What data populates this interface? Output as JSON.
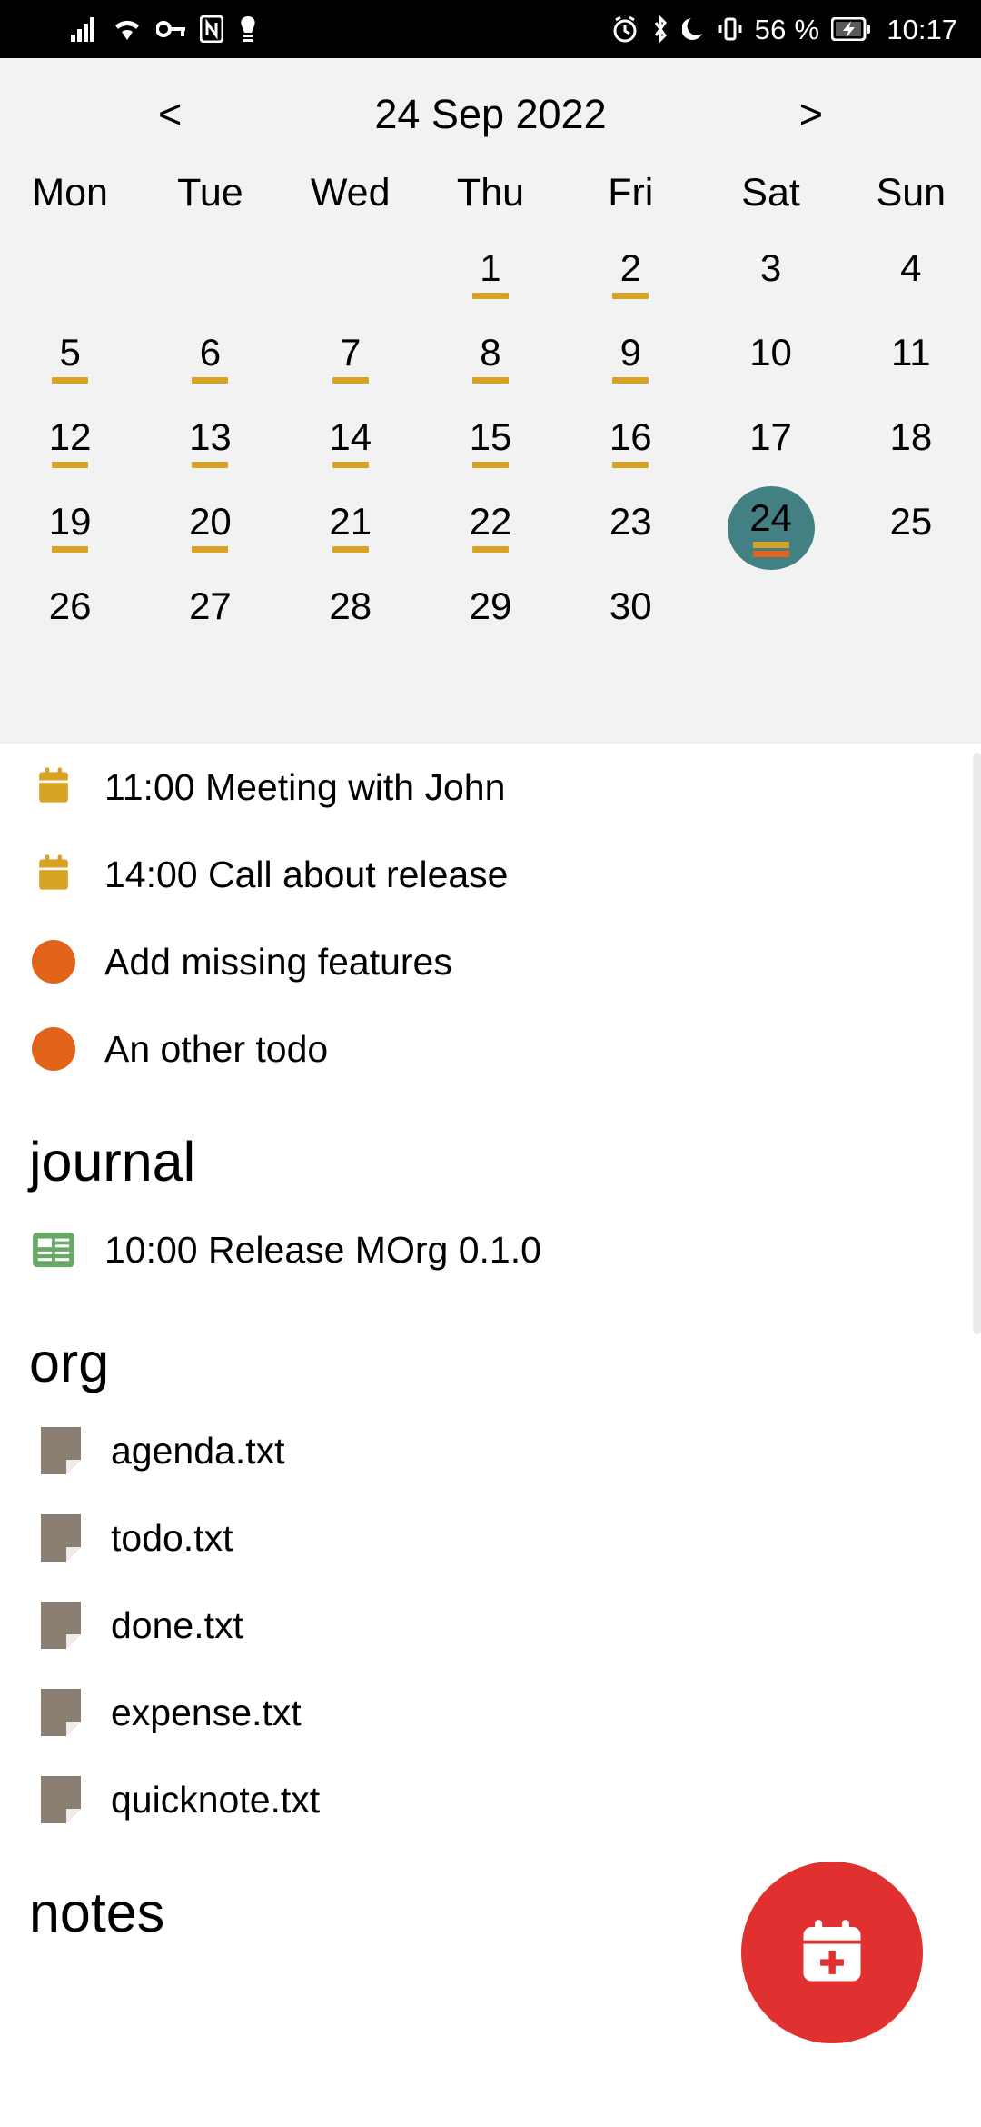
{
  "status_bar": {
    "left_icons": [
      "signal-bars-icon",
      "wifi-icon",
      "vpn-key-icon",
      "nfc-icon",
      "bulb-icon"
    ],
    "right_icons": [
      "alarm-icon",
      "bluetooth-icon",
      "do-not-disturb-icon",
      "vibrate-icon"
    ],
    "battery_percent": "56 %",
    "battery_icon": "battery-charging-icon",
    "clock": "10:17"
  },
  "calendar": {
    "prev_label": "<",
    "title": "24 Sep 2022",
    "next_label": ">",
    "weekdays": [
      "Mon",
      "Tue",
      "Wed",
      "Thu",
      "Fri",
      "Sat",
      "Sun"
    ],
    "selected_day": 24,
    "marker_colors": {
      "appointment": "#d8a325",
      "todo": "#e2631a"
    },
    "selected_bg": "#438083",
    "weeks": [
      [
        {
          "day": "",
          "marks": []
        },
        {
          "day": "",
          "marks": []
        },
        {
          "day": "",
          "marks": []
        },
        {
          "day": "1",
          "marks": [
            "appointment"
          ]
        },
        {
          "day": "2",
          "marks": [
            "appointment"
          ]
        },
        {
          "day": "3",
          "marks": []
        },
        {
          "day": "4",
          "marks": []
        }
      ],
      [
        {
          "day": "5",
          "marks": [
            "appointment"
          ]
        },
        {
          "day": "6",
          "marks": [
            "appointment"
          ]
        },
        {
          "day": "7",
          "marks": [
            "appointment"
          ]
        },
        {
          "day": "8",
          "marks": [
            "appointment"
          ]
        },
        {
          "day": "9",
          "marks": [
            "appointment"
          ]
        },
        {
          "day": "10",
          "marks": []
        },
        {
          "day": "11",
          "marks": []
        }
      ],
      [
        {
          "day": "12",
          "marks": [
            "appointment"
          ]
        },
        {
          "day": "13",
          "marks": [
            "appointment"
          ]
        },
        {
          "day": "14",
          "marks": [
            "appointment"
          ]
        },
        {
          "day": "15",
          "marks": [
            "appointment"
          ]
        },
        {
          "day": "16",
          "marks": [
            "appointment"
          ]
        },
        {
          "day": "17",
          "marks": []
        },
        {
          "day": "18",
          "marks": []
        }
      ],
      [
        {
          "day": "19",
          "marks": [
            "appointment"
          ]
        },
        {
          "day": "20",
          "marks": [
            "appointment"
          ]
        },
        {
          "day": "21",
          "marks": [
            "appointment"
          ]
        },
        {
          "day": "22",
          "marks": [
            "appointment"
          ]
        },
        {
          "day": "23",
          "marks": []
        },
        {
          "day": "24",
          "marks": [
            "appointment",
            "todo"
          ],
          "selected": true
        },
        {
          "day": "25",
          "marks": []
        }
      ],
      [
        {
          "day": "26",
          "marks": []
        },
        {
          "day": "27",
          "marks": []
        },
        {
          "day": "28",
          "marks": []
        },
        {
          "day": "29",
          "marks": []
        },
        {
          "day": "30",
          "marks": []
        },
        {
          "day": "",
          "marks": []
        },
        {
          "day": "",
          "marks": []
        }
      ]
    ]
  },
  "agenda": {
    "items": [
      {
        "icon": "calendar-icon",
        "icon_color": "#d8a325",
        "label": "11:00 Meeting with John"
      },
      {
        "icon": "calendar-icon",
        "icon_color": "#d8a325",
        "label": "14:00 Call about release"
      },
      {
        "icon": "todo-dot-icon",
        "icon_color": "#e2631a",
        "label": "Add missing features"
      },
      {
        "icon": "todo-dot-icon",
        "icon_color": "#e2631a",
        "label": "An other todo"
      }
    ]
  },
  "journal": {
    "title": "journal",
    "items": [
      {
        "icon": "article-icon",
        "icon_color": "#6aa86a",
        "label": "10:00 Release MOrg 0.1.0"
      }
    ]
  },
  "org": {
    "title": "org",
    "file_icon_color": "#8a7f72",
    "files": [
      {
        "icon": "text-file-icon",
        "label": "agenda.txt"
      },
      {
        "icon": "text-file-icon",
        "label": "todo.txt"
      },
      {
        "icon": "text-file-icon",
        "label": "done.txt"
      },
      {
        "icon": "text-file-icon",
        "label": "expense.txt"
      },
      {
        "icon": "text-file-icon",
        "label": "quicknote.txt"
      }
    ]
  },
  "notes": {
    "title": "notes"
  },
  "fab": {
    "icon": "calendar-plus-icon",
    "color": "#e13030"
  }
}
